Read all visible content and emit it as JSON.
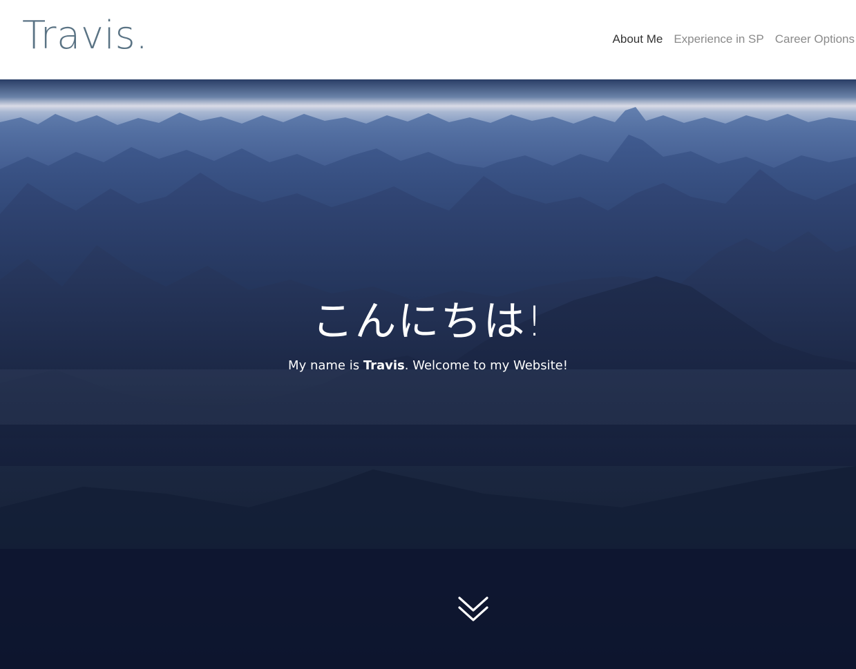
{
  "header": {
    "logo": "Travis."
  },
  "nav": {
    "items": [
      {
        "label": "About Me"
      },
      {
        "label": "Experience in SP"
      },
      {
        "label": "Career Options"
      }
    ]
  },
  "hero": {
    "greeting": "こんにちは!",
    "intro_prefix": "My name is ",
    "intro_name": "Travis",
    "intro_suffix": ". Welcome to my Website!"
  },
  "icons": {
    "scroll": "double-chevron-down-icon"
  },
  "colors": {
    "logo": "#5a7384",
    "nav_active": "#333333",
    "nav_inactive": "#8a8a8a",
    "hero_text": "#ffffff"
  }
}
